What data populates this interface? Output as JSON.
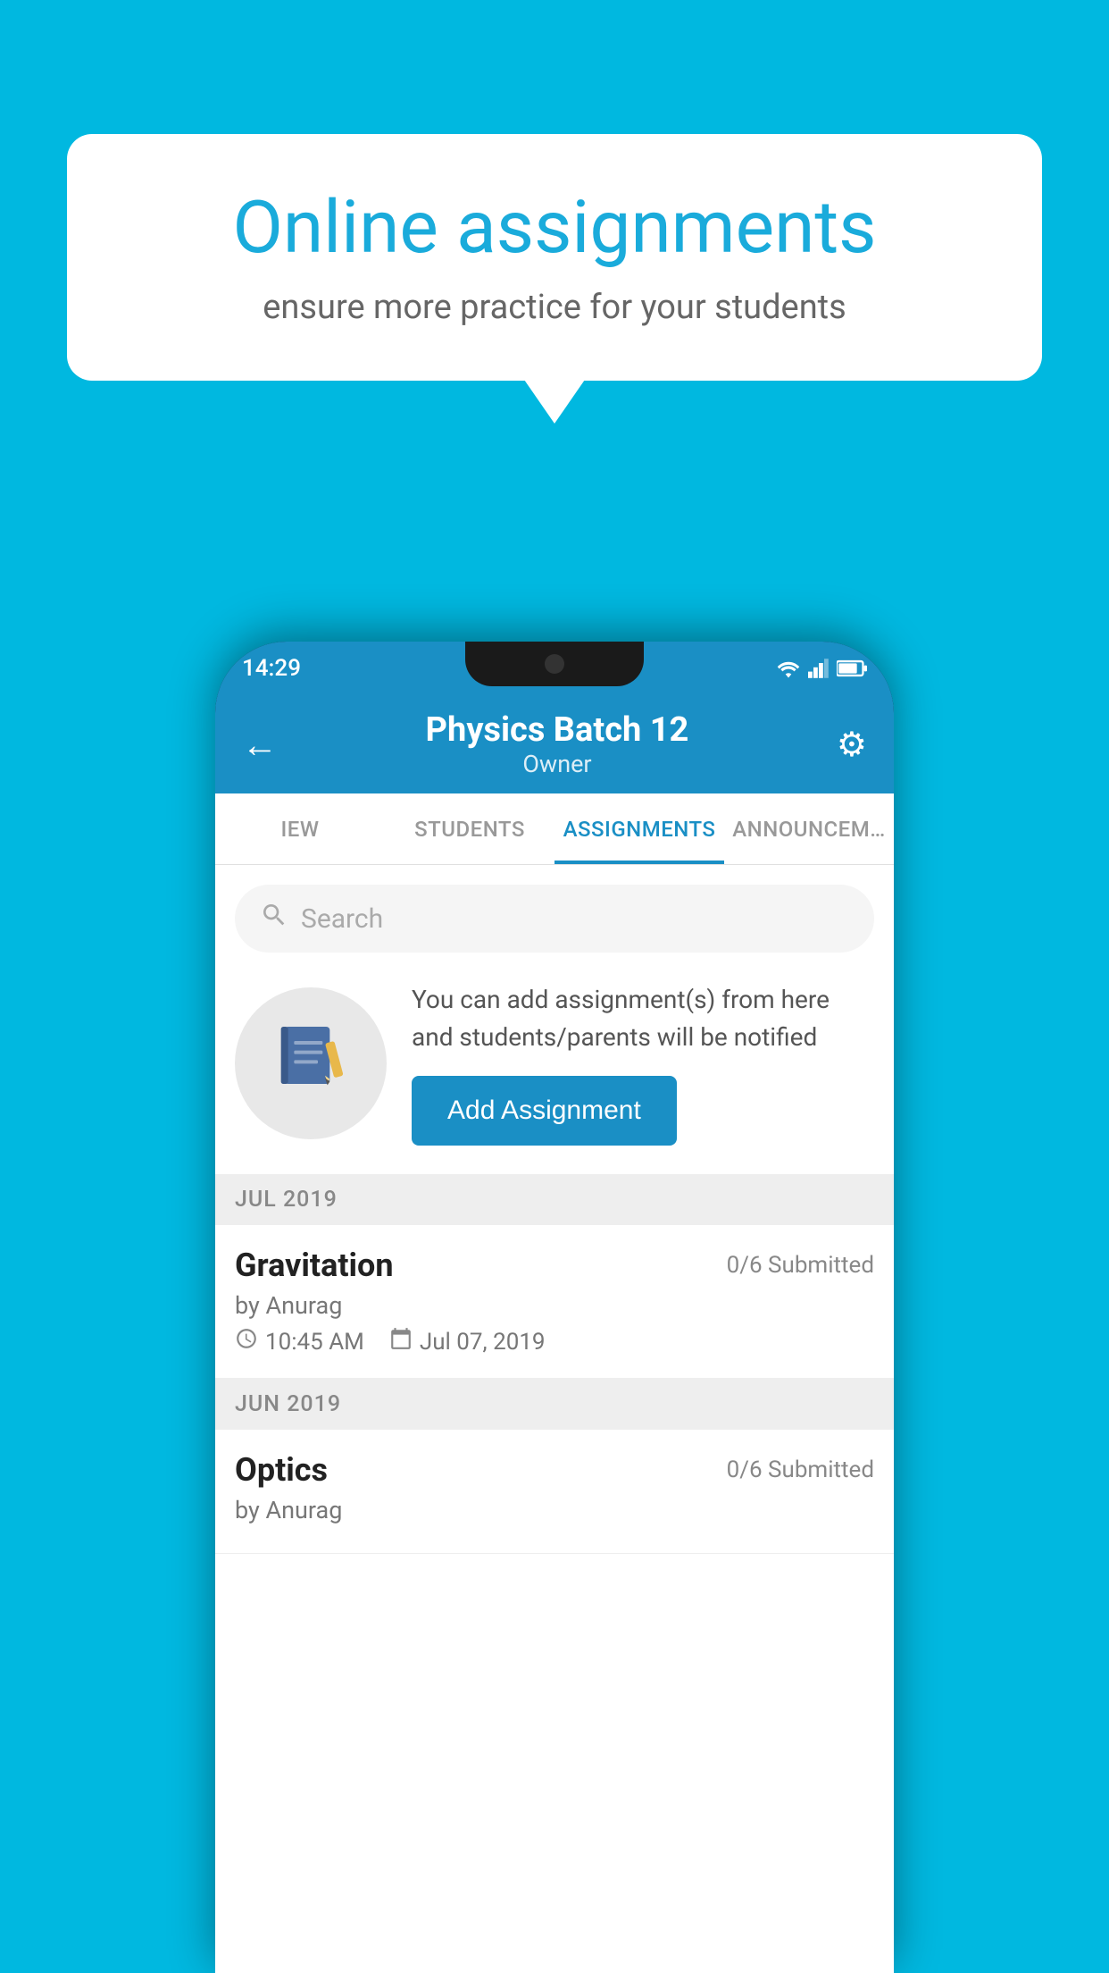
{
  "background": {
    "color": "#00b8e0"
  },
  "speech_bubble": {
    "title": "Online assignments",
    "subtitle": "ensure more practice for your students"
  },
  "status_bar": {
    "time": "14:29"
  },
  "header": {
    "title": "Physics Batch 12",
    "subtitle": "Owner",
    "back_label": "←",
    "settings_label": "⚙"
  },
  "tabs": [
    {
      "label": "IEW",
      "active": false
    },
    {
      "label": "STUDENTS",
      "active": false
    },
    {
      "label": "ASSIGNMENTS",
      "active": true
    },
    {
      "label": "ANNOUNCEM…",
      "active": false
    }
  ],
  "search": {
    "placeholder": "Search"
  },
  "promo": {
    "description": "You can add assignment(s) from here and students/parents will be notified",
    "button_label": "Add Assignment"
  },
  "sections": [
    {
      "label": "JUL 2019",
      "assignments": [
        {
          "name": "Gravitation",
          "submitted": "0/6 Submitted",
          "by": "by Anurag",
          "time": "10:45 AM",
          "date": "Jul 07, 2019"
        }
      ]
    },
    {
      "label": "JUN 2019",
      "assignments": [
        {
          "name": "Optics",
          "submitted": "0/6 Submitted",
          "by": "by Anurag",
          "time": "",
          "date": ""
        }
      ]
    }
  ]
}
